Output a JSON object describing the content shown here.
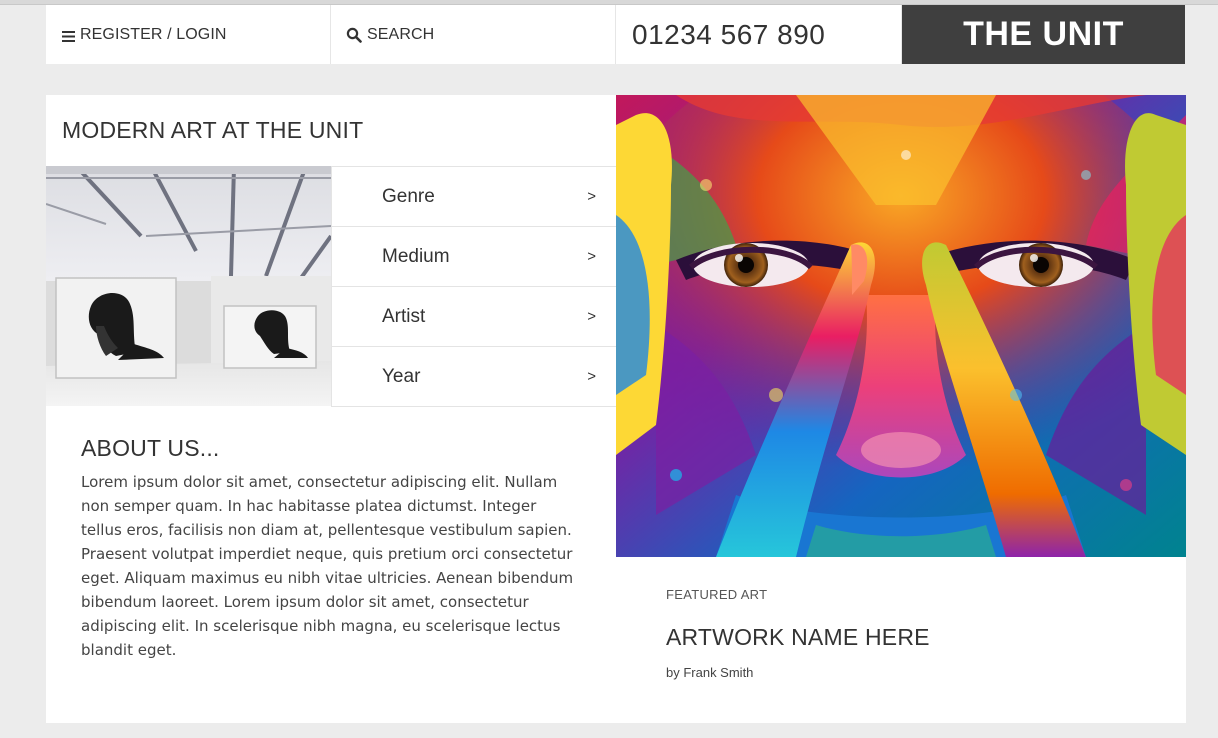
{
  "header": {
    "menu_label": "REGISTER / LOGIN",
    "search_label": "SEARCH",
    "phone": "01234 567 890",
    "brand": "THE UNIT"
  },
  "main": {
    "title": "MODERN ART AT THE UNIT",
    "nav": [
      {
        "label": "Genre",
        "arrow": ">"
      },
      {
        "label": "Medium",
        "arrow": ">"
      },
      {
        "label": "Artist",
        "arrow": ">"
      },
      {
        "label": "Year",
        "arrow": ">"
      }
    ],
    "about": {
      "title": "ABOUT US...",
      "text": "Lorem ipsum dolor sit amet, consectetur adipiscing elit. Nullam non semper quam. In hac habitasse platea dictumst. Integer tellus eros, facilisis non diam at, pellentesque vestibulum sapien. Praesent volutpat imperdiet neque, quis pretium orci consectetur eget. Aliquam maximus eu nibh vitae ultricies. Aenean bibendum bibendum laoreet. Lorem ipsum dolor sit amet, consectetur adipiscing elit. In scelerisque nibh magna, eu scelerisque lectus blandit eget."
    },
    "featured": {
      "kicker": "FEATURED ART",
      "title": "ARTWORK NAME HERE",
      "byline": "by Frank Smith"
    }
  },
  "colors": {
    "page_bg": "#ececec",
    "brand_bg": "#3f3f3f",
    "brand_text": "#ffffff",
    "text": "#333333"
  },
  "icons": {
    "menu": "hamburger-icon",
    "search": "search-icon"
  }
}
